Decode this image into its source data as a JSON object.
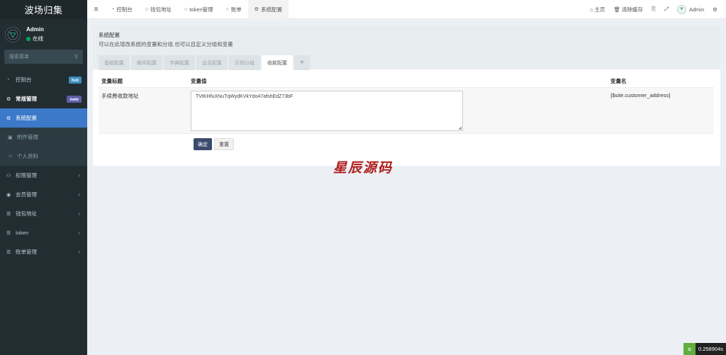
{
  "app": {
    "title": "波场归集"
  },
  "user": {
    "name": "Admin",
    "status": "在线"
  },
  "search": {
    "placeholder": "搜索菜单"
  },
  "sidebar": {
    "items": [
      {
        "label": "控制台",
        "badge": "hot",
        "badge_color": "#3c8dbc"
      },
      {
        "label": "常规管理",
        "badge": "new",
        "badge_color": "#605ca8"
      },
      {
        "label": "系统配置"
      },
      {
        "label": "附件管理"
      },
      {
        "label": "个人资料"
      },
      {
        "label": "权限管理"
      },
      {
        "label": "会员管理"
      },
      {
        "label": "钱包地址"
      },
      {
        "label": "token"
      },
      {
        "label": "账单管理"
      }
    ]
  },
  "topbar": {
    "tabs": [
      {
        "label": "控制台"
      },
      {
        "label": "钱包地址"
      },
      {
        "label": "token管理"
      },
      {
        "label": "账单"
      },
      {
        "label": "系统配置"
      }
    ],
    "home": "主页",
    "clear_cache": "清除缓存",
    "admin": "Admin"
  },
  "page": {
    "title": "系统配置",
    "description": "可以在此增改系统的变量和分组,也可以自定义分组和变量",
    "tabs": [
      "基础配置",
      "邮件配置",
      "字典配置",
      "会员配置",
      "示例分组",
      "收款配置"
    ],
    "add_tab": "+"
  },
  "table": {
    "headers": [
      "变量标题",
      "变量值",
      "变量名"
    ],
    "rows": [
      {
        "title": "手续费收款地址",
        "value": "TVtKHfuXNuTqWydKVkYdo47afshEdZ73bF",
        "name": "{$site.customer_address}"
      }
    ]
  },
  "buttons": {
    "confirm": "确定",
    "reset": "重置"
  },
  "watermark": "星辰源码",
  "timer": "0.258904s",
  "colors": {
    "sidebar": "#222d32",
    "active": "#3c79c9",
    "primary_button": "#3a4b6d"
  }
}
